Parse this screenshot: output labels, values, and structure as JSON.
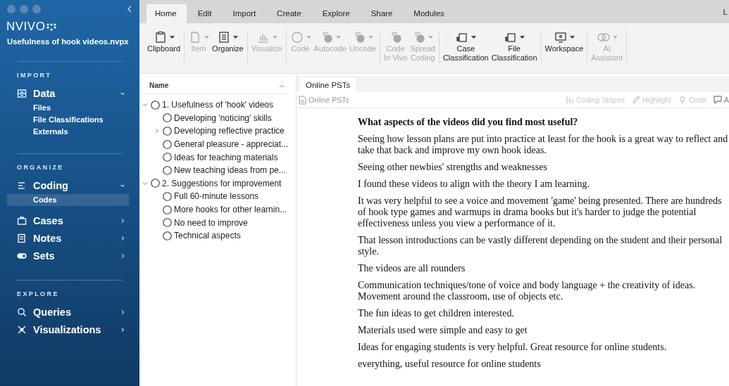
{
  "sidebar": {
    "title": "NVIVO",
    "project": "Usefulness of hook videos.nvpx",
    "sections": [
      {
        "heading": "IMPORT",
        "items": [
          {
            "label": "Data",
            "expanded": true,
            "children": [
              {
                "label": "Files",
                "selected": false
              },
              {
                "label": "File Classifications",
                "selected": false
              },
              {
                "label": "Externals",
                "selected": false
              }
            ]
          }
        ]
      },
      {
        "heading": "ORGANIZE",
        "items": [
          {
            "label": "Coding",
            "expanded": true,
            "children": [
              {
                "label": "Codes",
                "selected": true
              }
            ]
          },
          {
            "label": "Cases",
            "expanded": false
          },
          {
            "label": "Notes",
            "expanded": false
          },
          {
            "label": "Sets",
            "expanded": false
          }
        ]
      },
      {
        "heading": "EXPLORE",
        "items": [
          {
            "label": "Queries",
            "expanded": false
          },
          {
            "label": "Visualizations",
            "expanded": false
          }
        ]
      }
    ]
  },
  "ribbon": {
    "tabs": [
      {
        "label": "Home",
        "selected": true
      },
      {
        "label": "Edit",
        "selected": false
      },
      {
        "label": "Import",
        "selected": false
      },
      {
        "label": "Create",
        "selected": false
      },
      {
        "label": "Explore",
        "selected": false
      },
      {
        "label": "Share",
        "selected": false
      },
      {
        "label": "Modules",
        "selected": false
      }
    ],
    "right_label": "L",
    "groups": [
      [
        {
          "label": "Clipboard",
          "disabled": false,
          "menu": true
        }
      ],
      [
        {
          "label": "Item",
          "disabled": true,
          "menu": true
        },
        {
          "label": "Organize",
          "disabled": false,
          "menu": true
        }
      ],
      [
        {
          "label": "Visualize",
          "disabled": true,
          "menu": true
        }
      ],
      [
        {
          "label": "Code",
          "disabled": true,
          "menu": true
        },
        {
          "label": "Autocode",
          "disabled": true,
          "menu": true
        },
        {
          "label": "Uncode",
          "disabled": true,
          "menu": true
        }
      ],
      [
        {
          "label": "Code\nIn Vivo",
          "disabled": true,
          "menu": false
        },
        {
          "label": "Spread\nCoding",
          "disabled": true,
          "menu": true
        }
      ],
      [
        {
          "label": "Case\nClassification",
          "disabled": false,
          "menu": true
        },
        {
          "label": "File\nClassification",
          "disabled": false,
          "menu": true
        }
      ],
      [
        {
          "label": "Workspace",
          "disabled": false,
          "menu": true
        }
      ],
      [
        {
          "label": "AI\nAssistant",
          "disabled": true,
          "menu": true
        }
      ]
    ]
  },
  "codes": {
    "column": "Name",
    "nodes": [
      {
        "label": "1. Usefulness of 'hook' videos",
        "kind": "branch",
        "expanded": true,
        "children": [
          {
            "label": "Developing 'noticing' skills",
            "kind": "leaf"
          },
          {
            "label": "Developing reflective practice",
            "kind": "branch",
            "expanded": false
          },
          {
            "label": "General pleasure - appreciat...",
            "kind": "leaf"
          },
          {
            "label": "Ideas for teaching materials",
            "kind": "leaf"
          },
          {
            "label": "New teaching ideas from pe...",
            "kind": "leaf"
          }
        ]
      },
      {
        "label": "2. Suggestions for improvement",
        "kind": "branch",
        "expanded": true,
        "children": [
          {
            "label": "Full 60-minute lessons",
            "kind": "leaf"
          },
          {
            "label": "More hooks for other learnin...",
            "kind": "leaf"
          },
          {
            "label": "No need to improve",
            "kind": "leaf"
          },
          {
            "label": "Technical aspects",
            "kind": "leaf"
          }
        ]
      }
    ]
  },
  "document": {
    "tab": {
      "label": "Online PSTs",
      "selected": true
    },
    "name": "Online PSTs",
    "tools": [
      "Coding Stripes",
      "Highlight",
      "Code",
      "A"
    ],
    "heading": "What aspects of the videos did you find most useful?",
    "paragraphs": [
      "Seeing how lesson plans are put into practice at least for the hook is a great way to reflect and take that back and improve my own hook ideas.",
      "Seeing other newbies' strengths and weaknesses",
      "I found these videos to align with the theory I am learning.",
      "It was very helpful to see a voice and movement 'game' being presented. There are hundreds of hook type games and warmups in drama books but it's harder to judge the potential effectiveness unless you view a performance of it.",
      "That lesson introductions can be vastly different depending on the student and their personal style.",
      "The videos are all rounders",
      "Communication techniques/tone of voice and body language + the creativity of ideas. Movement around the classroom, use of objects etc.",
      "The fun ideas to get children interested.",
      "Materials used were simple and easy to get",
      "Ideas for engaging students is very helpful. Great resource for online students.",
      "everything, useful resource for online students"
    ]
  }
}
